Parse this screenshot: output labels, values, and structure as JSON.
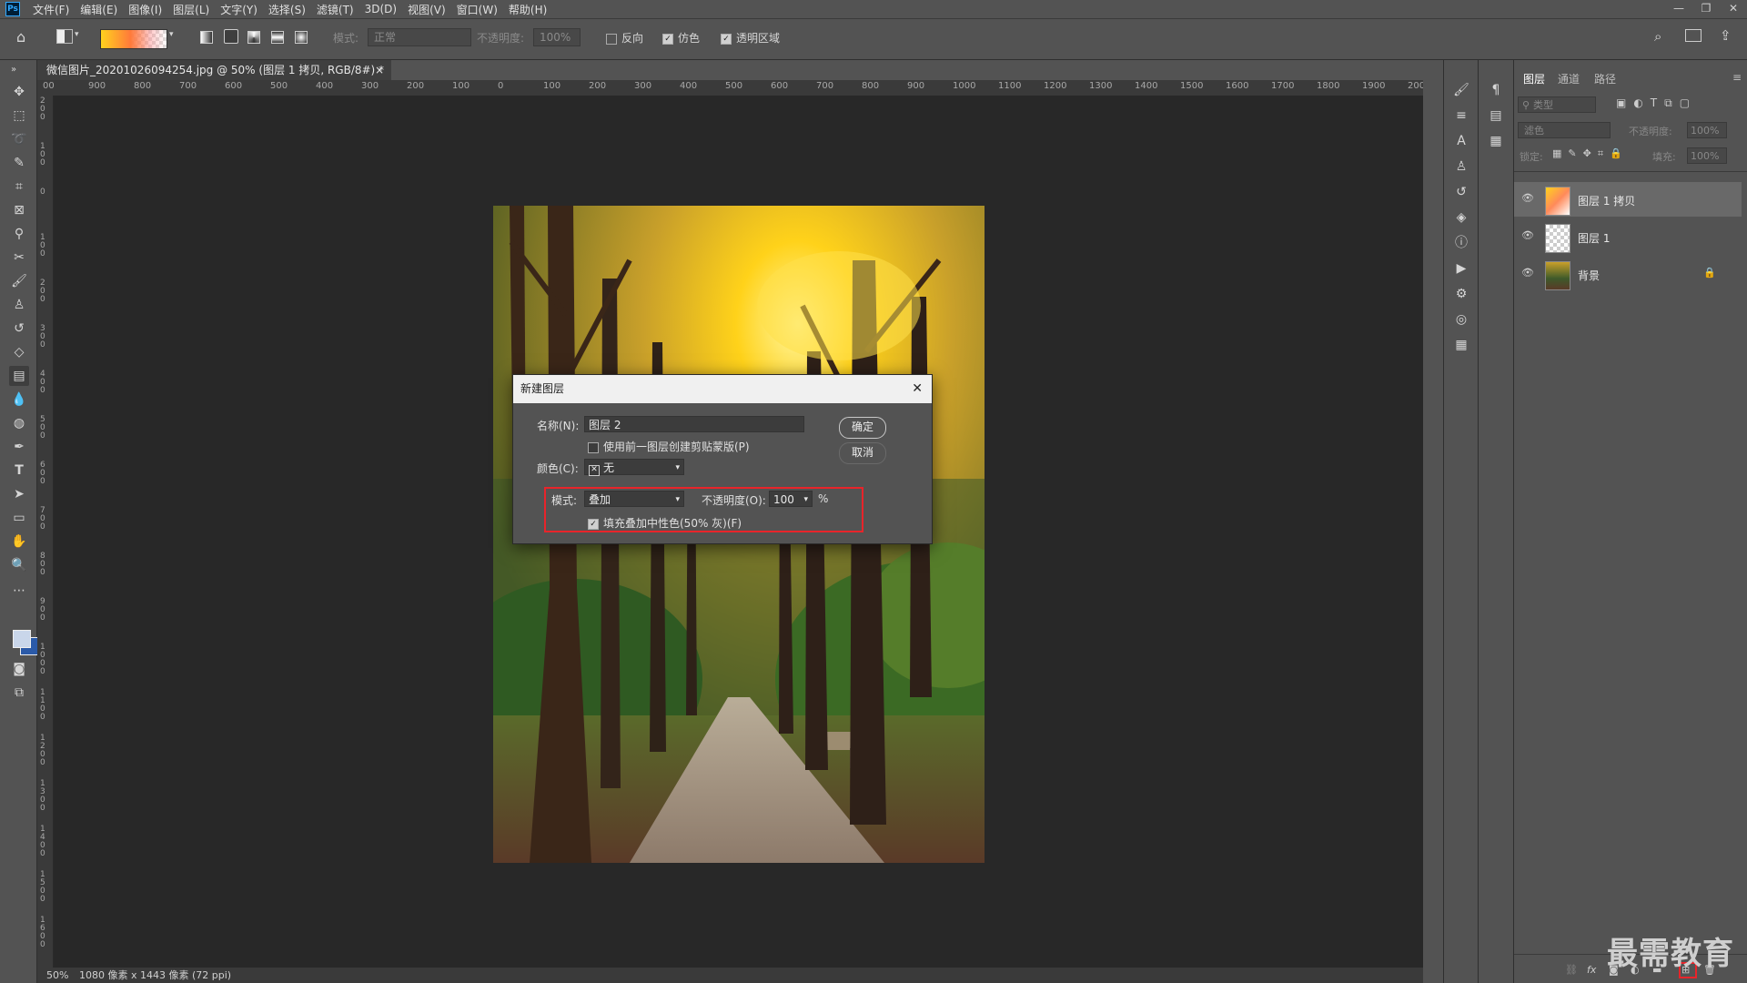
{
  "menubar": {
    "logo": "Ps",
    "items": [
      "文件(F)",
      "编辑(E)",
      "图像(I)",
      "图层(L)",
      "文字(Y)",
      "选择(S)",
      "滤镜(T)",
      "3D(D)",
      "视图(V)",
      "窗口(W)",
      "帮助(H)"
    ],
    "window_controls": [
      "—",
      "❐",
      "✕"
    ]
  },
  "options": {
    "mode_label": "模式:",
    "mode_value": "正常",
    "opacity_label": "不透明度:",
    "opacity_value": "100%",
    "reverse_label": "反向",
    "dither_label": "仿色",
    "transparency_label": "透明区域"
  },
  "document": {
    "tab_title": "微信图片_20201026094254.jpg @ 50% (图层 1 拷贝, RGB/8#) *",
    "tab_close": "×",
    "ruler_top": [
      "00",
      "900",
      "800",
      "700",
      "600",
      "500",
      "400",
      "300",
      "200",
      "100",
      "0",
      "100",
      "200",
      "300",
      "400",
      "500",
      "600",
      "700",
      "800",
      "900",
      "1000",
      "1100",
      "1200",
      "1300",
      "1400",
      "1500",
      "1600",
      "1700",
      "1800",
      "1900",
      "200"
    ],
    "ruler_left": [
      "200",
      "100",
      "0",
      "100",
      "200",
      "300",
      "400",
      "500",
      "600",
      "700",
      "800",
      "900",
      "1000",
      "1100",
      "1200",
      "1300",
      "1400",
      "1500",
      "1600"
    ],
    "zoom": "50%",
    "size_info": "1080 像素 x 1443 像素 (72 ppi)"
  },
  "dialog": {
    "title": "新建图层",
    "close": "✕",
    "name_label": "名称(N):",
    "name_value": "图层 2",
    "clip_label": "使用前一图层创建剪贴蒙版(P)",
    "color_label": "颜色(C):",
    "color_value": "无",
    "mode_label": "模式:",
    "mode_value": "叠加",
    "opacity_label": "不透明度(O):",
    "opacity_value": "100",
    "percent": "%",
    "fill_label": "填充叠加中性色(50% 灰)(F)",
    "ok": "确定",
    "cancel": "取消"
  },
  "layers_panel": {
    "tabs": [
      "图层",
      "通道",
      "路径"
    ],
    "kind_placeholder": "类型",
    "blend_mode": "滤色",
    "opacity_label": "不透明度:",
    "opacity_value": "100%",
    "lock_label": "锁定:",
    "fill_label": "填充:",
    "fill_value": "100%",
    "layers": [
      {
        "name": "图层 1 拷贝",
        "selected": true
      },
      {
        "name": "图层 1",
        "selected": false
      },
      {
        "name": "背景",
        "selected": false,
        "locked": true
      }
    ]
  },
  "watermark": "最需教育",
  "colors": {
    "accent_highlight": "#e8242a",
    "foreground": "#c9d6ea",
    "background": "#2b5aa8"
  }
}
